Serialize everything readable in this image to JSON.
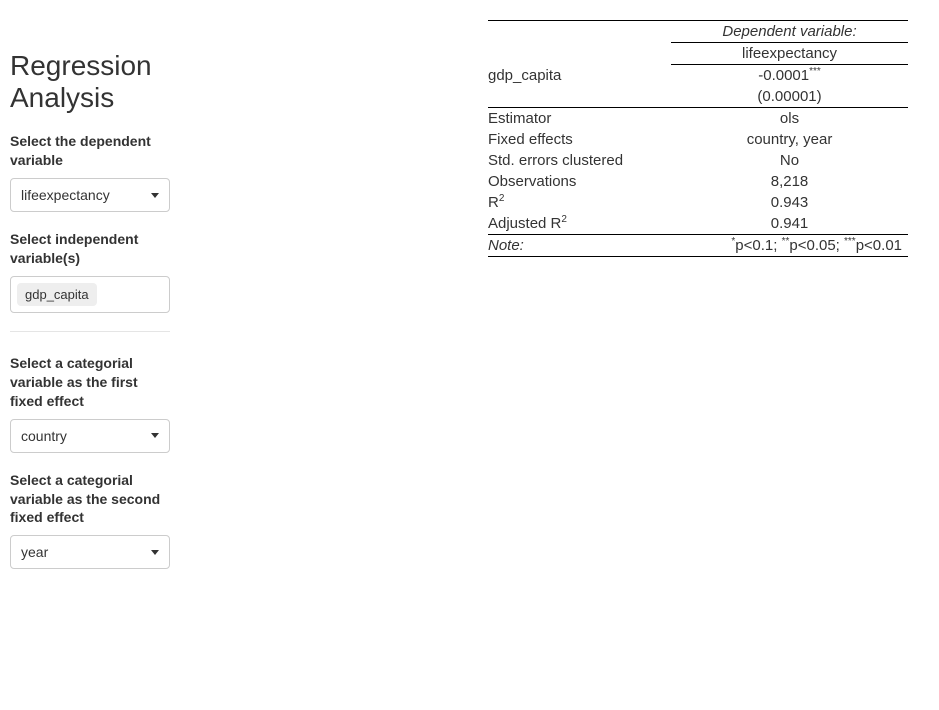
{
  "sidebar": {
    "title": "Regression Analysis",
    "dep_label": "Select the dependent variable",
    "dep_value": "lifeexpectancy",
    "indep_label": "Select independent variable(s)",
    "indep_tokens": [
      "gdp_capita"
    ],
    "fe1_label": "Select a categorial variable as the first fixed effect",
    "fe1_value": "country",
    "fe2_label": "Select a categorial variable as the second fixed effect",
    "fe2_value": "year"
  },
  "table": {
    "dep_header": "Dependent variable:",
    "dep_name": "lifeexpectancy",
    "coeff_label": "gdp_capita",
    "coeff_value": "-0.0001",
    "coeff_stars": "***",
    "coeff_se": "(0.00001)",
    "rows": {
      "estimator_label": "Estimator",
      "estimator_value": "ols",
      "fe_label": "Fixed effects",
      "fe_value": "country, year",
      "se_cluster_label": "Std. errors clustered",
      "se_cluster_value": "No",
      "obs_label": "Observations",
      "obs_value": "8,218",
      "r2_label": "R",
      "r2_value": "0.943",
      "adjr2_label": "Adjusted R",
      "adjr2_value": "0.941"
    },
    "note_label": "Note:",
    "note_value": "*p<0.1; **p<0.05; ***p<0.01"
  }
}
